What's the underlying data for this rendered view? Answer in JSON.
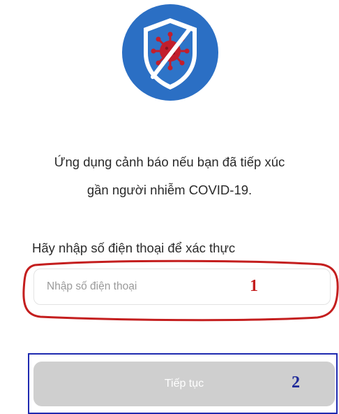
{
  "app": {
    "logo": {
      "icon": "shield-virus-icon",
      "colors": {
        "circle": "#2b6fc4",
        "shield": "#ffffff",
        "shield_inner": "#2e74c8",
        "virus": "#c21e2c",
        "slash": "#ffffff"
      }
    }
  },
  "message": {
    "line1": "Ứng dụng cảnh báo nếu bạn đã tiếp xúc",
    "line2": "gần người nhiễm COVID-19."
  },
  "phone_form": {
    "label": "Hãy nhập số điện thoại để xác thực",
    "input_value": "",
    "input_placeholder": "Nhập số điện thoại",
    "continue_label": "Tiếp tục",
    "button_color": "#cfcfcf"
  },
  "annotations": {
    "marker_1": "1",
    "marker_2": "2",
    "color_1": "#c41e1e",
    "color_2": "#1f2ab0"
  }
}
